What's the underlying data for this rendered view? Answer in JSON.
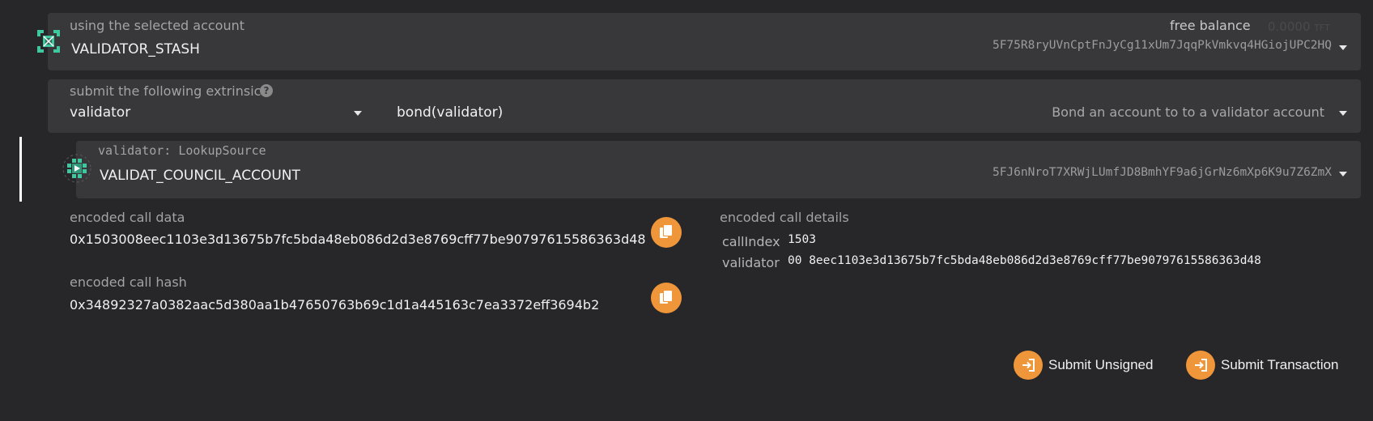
{
  "account": {
    "label": "using the selected account",
    "name": "VALIDATOR_STASH",
    "free_balance_label": "free balance",
    "free_balance_value": "0.0000",
    "free_balance_unit": "TFT",
    "address": "5F75R8ryUVnCptFnJyCg11xUm7JqqPkVmkvq4HGiojUPC2HQ"
  },
  "extrinsic": {
    "label": "submit the following extrinsic",
    "help": "?",
    "module": "validator",
    "method": "bond(validator)",
    "description": "Bond an account to to a validator account"
  },
  "param": {
    "label": "validator: LookupSource",
    "name": "VALIDAT_COUNCIL_ACCOUNT",
    "address": "5FJ6nNroT7XRWjLUmfJD8BmhYF9a6jGrNz6mXp6K9u7Z6ZmX"
  },
  "encoded": {
    "data_label": "encoded call data",
    "data_value": "0x1503008eec1103e3d13675b7fc5bda48eb086d2d3e8769cff77be90797615586363d48",
    "hash_label": "encoded call hash",
    "hash_value": "0x34892327a0382aac5d380aa1b47650763b69c1d1a445163c7ea3372eff3694b2",
    "details_label": "encoded call details",
    "call_index_label": "callIndex",
    "call_index_value": "1503",
    "validator_label": "validator",
    "validator_value": "00 8eec1103e3d13675b7fc5bda48eb086d2d3e8769cff77be90797615586363d48"
  },
  "actions": {
    "submit_unsigned": "Submit Unsigned",
    "submit_transaction": "Submit Transaction"
  },
  "colors": {
    "background": "#27272a",
    "panel": "#38383b",
    "accent": "#f0963a",
    "identicon": "#3fc7a0"
  },
  "icons": [
    "account-identicon",
    "help-icon",
    "dropdown-caret-icon",
    "copy-icon",
    "sign-in-icon"
  ]
}
